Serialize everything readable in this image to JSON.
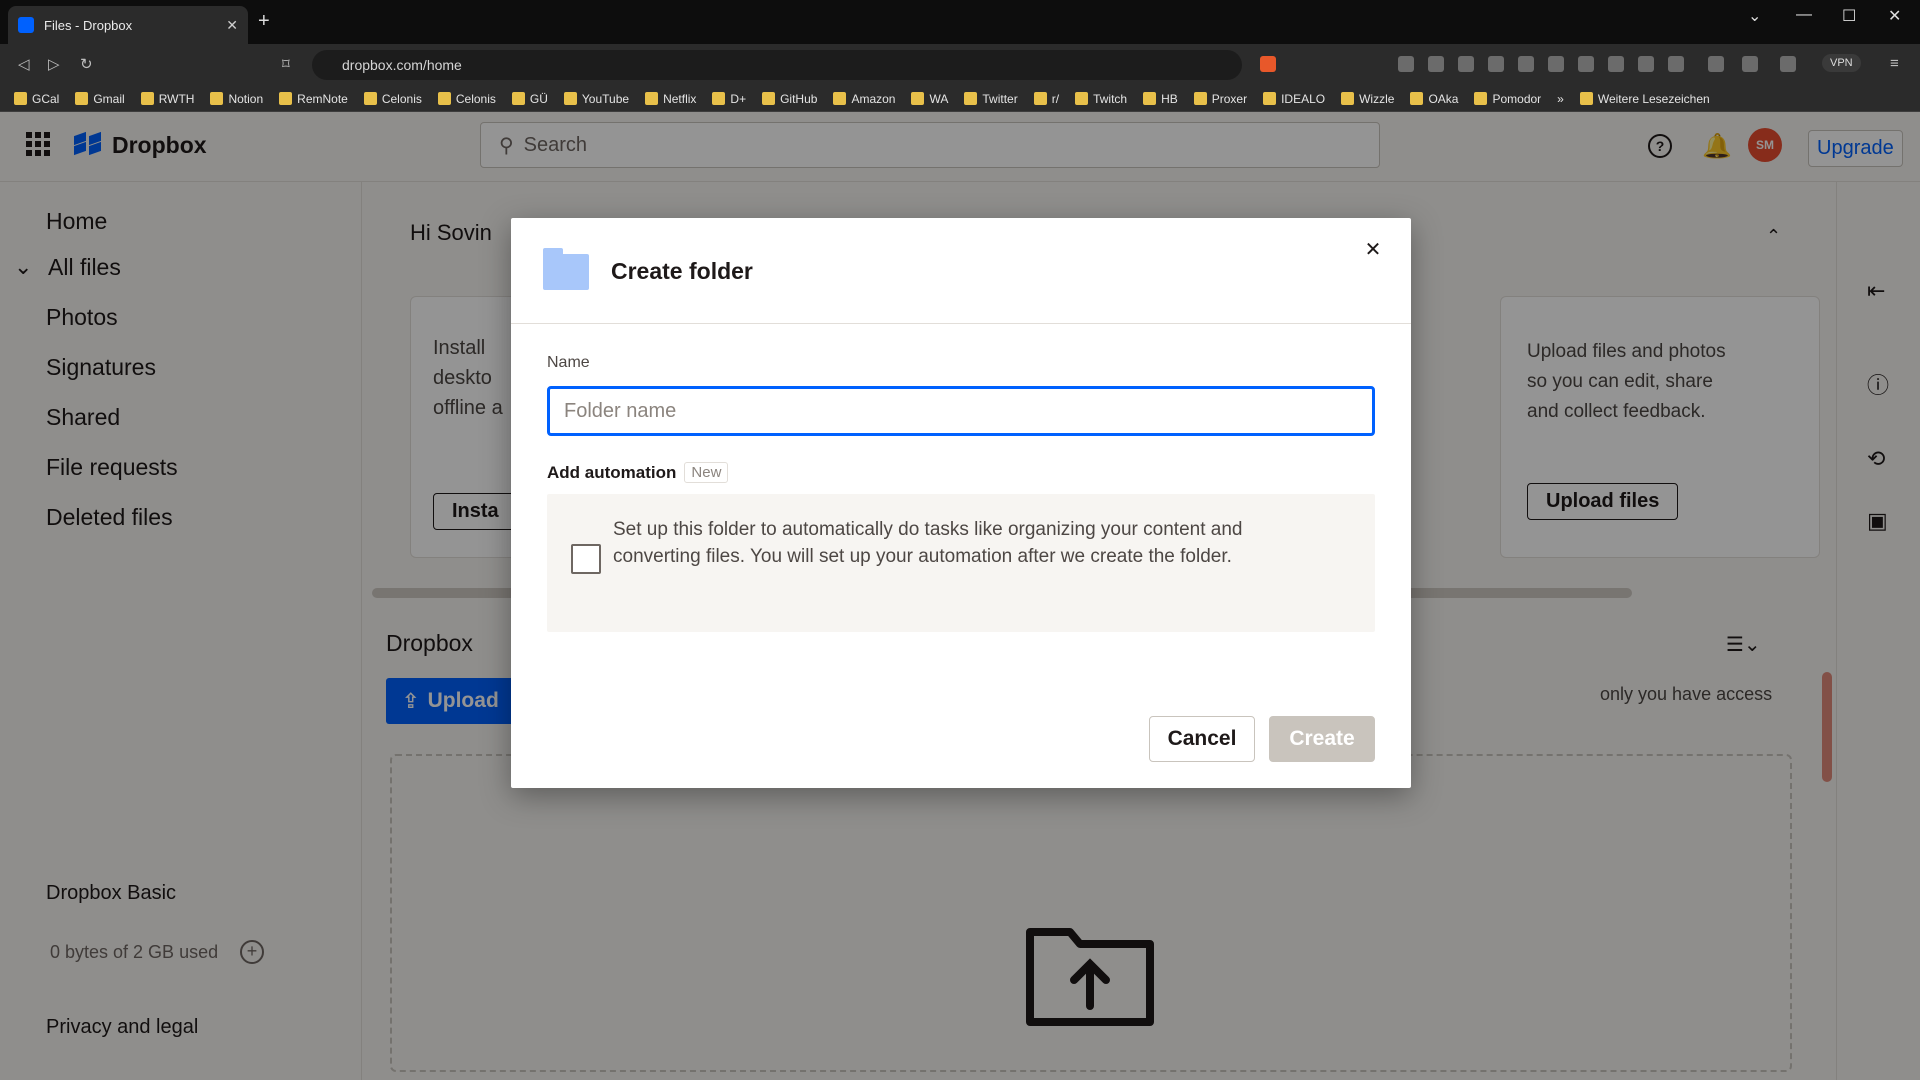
{
  "browser": {
    "tab_title": "Files - Dropbox",
    "tab_close": "✕",
    "new_tab": "+",
    "url": "dropbox.com/home",
    "vpn": "VPN",
    "window_controls": [
      "⌄",
      "—",
      "☐",
      "✕"
    ],
    "nav": [
      "◁",
      "▷",
      "↻"
    ],
    "bookmarks": [
      "GCal",
      "Gmail",
      "RWTH",
      "Notion",
      "RemNote",
      "Celonis",
      "Celonis",
      "GÜ",
      "YouTube",
      "Netflix",
      "D+",
      "GitHub",
      "Amazon",
      "WA",
      "Twitter",
      "r/",
      "Twitch",
      "HB",
      "Proxer",
      "IDEALO",
      "Wizzle",
      "OAka",
      "Pomodor",
      "»",
      "Weitere Lesezeichen"
    ]
  },
  "dropbox": {
    "logo_text": "Dropbox",
    "search_placeholder": "Search",
    "help": "?",
    "avatar_initials": "SM",
    "upgrade": "Upgrade",
    "sidebar": {
      "home": "Home",
      "all_files": "All files",
      "photos": "Photos",
      "signatures": "Signatures",
      "shared": "Shared",
      "file_requests": "File requests",
      "deleted_files": "Deleted files",
      "plan": "Dropbox Basic",
      "quota": "0 bytes of 2 GB used",
      "privacy": "Privacy and legal"
    },
    "greeting": "Hi Sovin",
    "card_install_text": "Install\ndeskto\noffline a",
    "card_install_btn": "Insta",
    "card_right_text": "Upload files and photos\nso you can edit, share\nand collect feedback.",
    "card_right_btn": "Upload files",
    "breadcrumb": "Dropbox",
    "upload_btn": "Upload",
    "access_note": "only you have access"
  },
  "modal": {
    "title": "Create folder",
    "close": "✕",
    "name_label": "Name",
    "name_placeholder": "Folder name",
    "name_value": "",
    "automation_title": "Add automation",
    "automation_badge": "New",
    "automation_text": "Set up this folder to automatically do tasks like organizing your content and converting files. You will set up your automation after we create the folder.",
    "cancel": "Cancel",
    "create": "Create"
  },
  "colors": {
    "accent": "#0061fe",
    "avatar": "#e84c2f",
    "disabled": "#c9c4bd"
  }
}
